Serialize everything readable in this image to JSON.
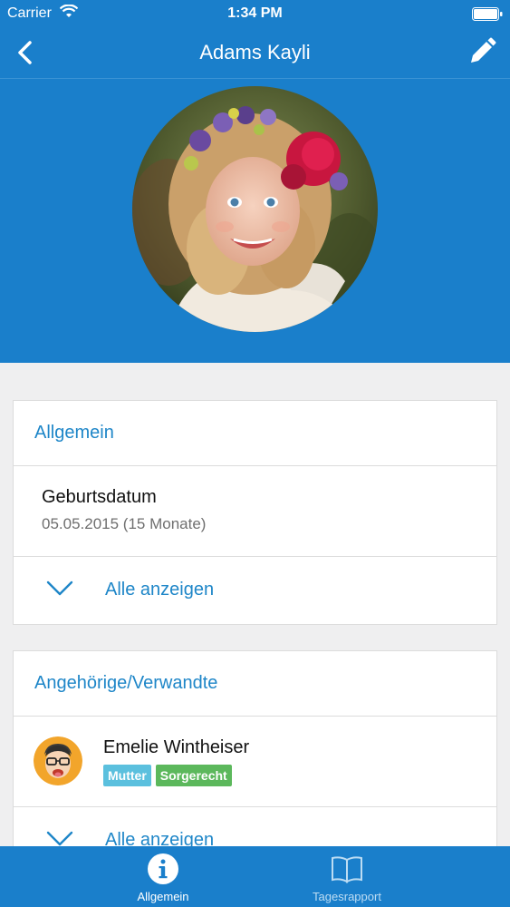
{
  "status_bar": {
    "carrier": "Carrier",
    "time": "1:34 PM"
  },
  "nav": {
    "title": "Adams Kayli",
    "back_icon": "chevron-left-icon",
    "edit_icon": "pencil-icon"
  },
  "general": {
    "header": "Allgemein",
    "fields": [
      {
        "label": "Geburtsdatum",
        "value": "05.05.2015 (15 Monate)"
      }
    ],
    "show_all": "Alle anzeigen"
  },
  "relatives": {
    "header": "Angehörige/Verwandte",
    "people": [
      {
        "name": "Emelie Wintheiser",
        "badges": [
          "Mutter",
          "Sorgerecht"
        ]
      }
    ],
    "show_all": "Alle anzeigen"
  },
  "tabs": [
    {
      "label": "Allgemein",
      "icon": "info-icon",
      "active": true
    },
    {
      "label": "Tagesrapport",
      "icon": "book-icon",
      "active": false
    }
  ],
  "colors": {
    "primary": "#1a7fcb",
    "link": "#1e86c8",
    "badge_role": "#5bc0de",
    "badge_custody": "#5cb85c"
  }
}
